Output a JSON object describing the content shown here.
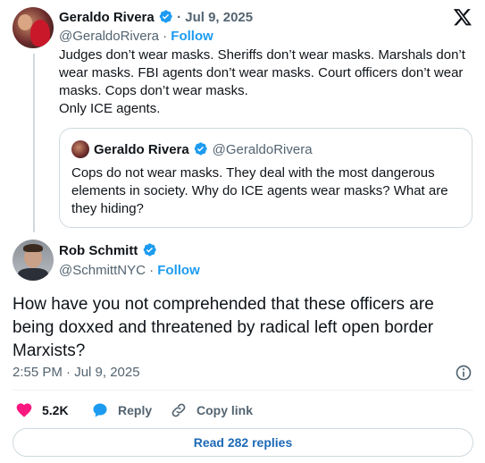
{
  "original_tweet": {
    "author_name": "Geraldo Rivera",
    "handle": "@GeraldoRivera",
    "follow_label": "Follow",
    "separator": "·",
    "date": "Jul 9, 2025",
    "text_lines": [
      "Judges don’t wear masks. Sheriffs don’t wear masks. Marshals don’t",
      "wear masks. FBI agents don’t wear masks. Court officers don’t wear",
      "masks. Cops don’t wear masks.",
      "Only ICE agents."
    ]
  },
  "quoted_tweet": {
    "author_name": "Geraldo Rivera",
    "handle": "@GeraldoRivera",
    "text_lines": [
      "Cops do not wear masks. They deal with the most dangerous",
      "elements in society. Why do ICE agents wear masks? What are",
      "they hiding?"
    ]
  },
  "reply_tweet": {
    "author_name": "Rob Schmitt",
    "handle": "@SchmittNYC",
    "follow_label": "Follow",
    "separator": "·",
    "text_lines": [
      "How have you not comprehended that these officers are",
      "being doxxed and threatened by radical left open border",
      "Marxists?"
    ],
    "timestamp": "2:55 PM · Jul 9, 2025"
  },
  "actions": {
    "likes": "5.2K",
    "reply_label": "Reply",
    "copy_link_label": "Copy link"
  },
  "read_replies_label": "Read 282 replies",
  "colors": {
    "accent_blue": "#1d9bf0",
    "like_pink": "#f91880",
    "text_muted": "#536471",
    "border": "#cfd9de"
  },
  "icons": [
    "verified-badge-icon",
    "x-logo-icon",
    "heart-icon",
    "reply-bubble-icon",
    "link-icon",
    "info-icon"
  ]
}
